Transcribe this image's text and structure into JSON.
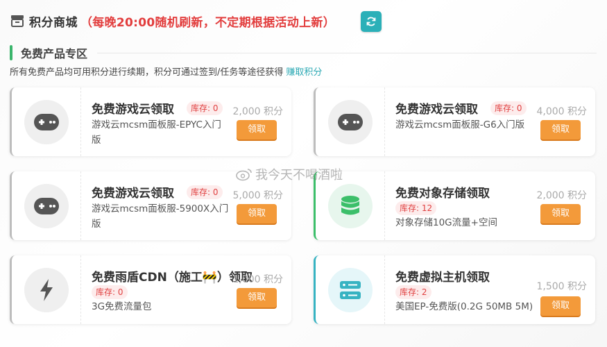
{
  "header": {
    "title": "积分商城",
    "note": "（每晚20:00随机刷新，不定期根据活动上新）",
    "icons": {
      "store": "store-icon",
      "refresh": "refresh-icon"
    },
    "refresh_color": "#2bb0b8"
  },
  "section": {
    "title": "免费产品专区",
    "description": "所有免费产品均可用积分进行续期，积分可通过签到/任务等途径获得",
    "earn_link": "赚取积分"
  },
  "products": [
    {
      "title": "免费游戏云领取",
      "stock": "库存: 0",
      "desc": "游戏云mcsm面板服-EPYC入门版",
      "points": "2,000 积分",
      "button": "领取",
      "icon": "gamepad-icon"
    },
    {
      "title": "免费游戏云领取",
      "stock": "库存: 0",
      "desc": "游戏云mcsm面板服-G6入门版",
      "points": "4,000 积分",
      "button": "领取",
      "icon": "gamepad-icon"
    },
    {
      "title": "免费游戏云领取",
      "stock": "库存: 0",
      "desc": "游戏云mcsm面板服-5900X入门版",
      "points": "5,000 积分",
      "button": "领取",
      "icon": "gamepad-icon"
    },
    {
      "title": "免费对象存储领取",
      "stock": "库存: 12",
      "desc": "对象存储10G流量+空间",
      "points": "2,000 积分",
      "button": "领取",
      "icon": "database-icon"
    },
    {
      "title": "免费雨盾CDN（施工🚧）领取",
      "stock": "库存: 0",
      "desc": "3G免费流量包",
      "points": "1,000 积分",
      "button": "领取",
      "icon": "lightning-icon"
    },
    {
      "title": "免费虚拟主机领取",
      "stock": "库存: 2",
      "desc": "美国EP-免费版(0.2G 50MB 5M)",
      "points": "1,500 积分",
      "button": "领取",
      "icon": "server-icon"
    }
  ],
  "watermark": "我今天不喝酒啦",
  "colors": {
    "accent_green": "#3bb56c",
    "button_orange": "#f39a3a",
    "stock_red": "#e04040",
    "link_teal": "#2aa8b3"
  }
}
